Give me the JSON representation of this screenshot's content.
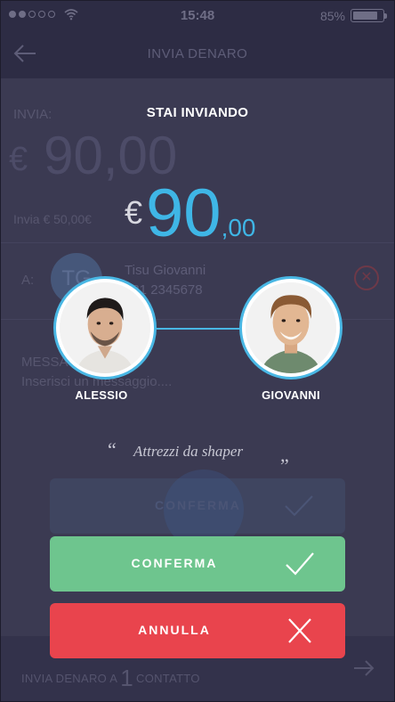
{
  "status_bar": {
    "time": "15:48",
    "battery_percent": "85%",
    "battery_level": 0.85,
    "signal_icon": "signal-dots-icon",
    "wifi_icon": "wifi-icon"
  },
  "nav": {
    "title": "INVIA DENARO",
    "back_icon": "arrow-left-icon"
  },
  "background_form": {
    "invia_label": "INVIA:",
    "amount_currency": "€",
    "amount_value": "90,00",
    "invia_min_prefix": "Invia € ",
    "invia_min_value": "50,00€",
    "a_label": "A:",
    "contact_initials": "TG",
    "contact_name": "Tisu Giovanni",
    "contact_phone": "331 2345678",
    "remove_icon": "close-circle-icon",
    "message_label": "MESSAGGIO",
    "message_placeholder": "Inserisci un messaggio....",
    "footer_prefix": "INVIA DENARO A",
    "footer_count": "1",
    "footer_suffix": "CONTATTO",
    "footer_icon": "arrow-right-icon"
  },
  "dialog": {
    "title": "STAI INVIANDO",
    "amount_currency": "€",
    "amount_integer": "90",
    "amount_decimal": ",00",
    "sender_name": "ALESSIO",
    "recipient_name": "GIOVANNI",
    "quote_open": "“",
    "quote_text": "Attrezzi da shaper",
    "quote_close": "”",
    "ghost_button_label": "CONFERMA",
    "confirm_label": "CONFERMA",
    "confirm_icon": "check-icon",
    "cancel_label": "ANNULLA",
    "cancel_icon": "x-icon"
  },
  "colors": {
    "background": "#3b3a52",
    "accent_blue": "#3fb6e6",
    "confirm_green": "#6ec58e",
    "cancel_red": "#e9444d"
  }
}
